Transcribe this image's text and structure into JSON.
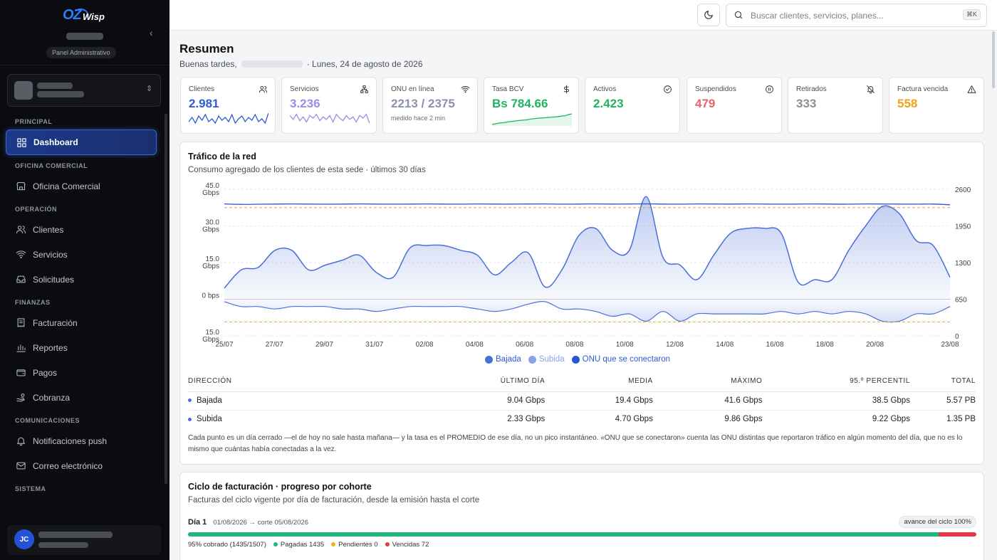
{
  "sidebar": {
    "brand": {
      "mark": "OZ",
      "word": "Wisp"
    },
    "panel_label": "Panel Administrativo",
    "sections": [
      {
        "title": "PRINCIPAL",
        "items": [
          {
            "label": "Dashboard",
            "icon": "grid-icon",
            "active": true
          }
        ]
      },
      {
        "title": "OFICINA COMERCIAL",
        "items": [
          {
            "label": "Oficina Comercial",
            "icon": "store-icon"
          }
        ]
      },
      {
        "title": "OPERACIÓN",
        "items": [
          {
            "label": "Clientes",
            "icon": "users-icon"
          },
          {
            "label": "Servicios",
            "icon": "wifi-icon"
          },
          {
            "label": "Solicitudes",
            "icon": "inbox-icon"
          }
        ]
      },
      {
        "title": "FINANZAS",
        "items": [
          {
            "label": "Facturación",
            "icon": "receipt-icon"
          },
          {
            "label": "Reportes",
            "icon": "bar-chart-icon"
          },
          {
            "label": "Pagos",
            "icon": "wallet-icon"
          },
          {
            "label": "Cobranza",
            "icon": "hand-coins-icon"
          }
        ]
      },
      {
        "title": "COMUNICACIONES",
        "items": [
          {
            "label": "Notificaciones push",
            "icon": "bell-icon"
          },
          {
            "label": "Correo electrónico",
            "icon": "mail-icon"
          }
        ]
      },
      {
        "title": "SISTEMA",
        "items": []
      }
    ],
    "user_initials": "JC"
  },
  "topbar": {
    "search_placeholder": "Buscar clientes, servicios, planes...",
    "shortcut": "⌘K"
  },
  "header": {
    "title": "Resumen",
    "greeting": "Buenas tardes,",
    "date": "· Lunes, 24 de agosto de 2026"
  },
  "kpis": [
    {
      "label": "Clientes",
      "value": "2.981",
      "color": "#2f5bd3",
      "icon": "users-icon"
    },
    {
      "label": "Servicios",
      "value": "3.236",
      "color": "#9d8be6",
      "icon": "network-icon"
    },
    {
      "label": "ONU en línea",
      "value": "2213 / 2375",
      "sub": "medido hace 2 min",
      "color": "#8a93ad",
      "icon": "wifi-icon"
    },
    {
      "label": "Tasa BCV",
      "value": "Bs 784.66",
      "color": "#1fb35f",
      "icon": "dollar-icon"
    },
    {
      "label": "Activos",
      "value": "2.423",
      "color": "#1fb35f",
      "icon": "check-circle-icon"
    },
    {
      "label": "Suspendidos",
      "value": "479",
      "color": "#e8646d",
      "icon": "pause-circle-icon"
    },
    {
      "label": "Retirados",
      "value": "333",
      "color": "#8a8f99",
      "icon": "bell-off-icon"
    },
    {
      "label": "Factura vencida",
      "value": "558",
      "color": "#f0a21a",
      "icon": "alert-triangle-icon"
    }
  ],
  "traffic": {
    "title": "Tráfico de la red",
    "subtitle": "Consumo agregado de los clientes de esta sede · últimos 30 días",
    "legend": [
      {
        "label": "Bajada",
        "color": "#4a6fd6"
      },
      {
        "label": "Subida",
        "color": "#8aa2e6"
      },
      {
        "label": "ONU que se conectaron",
        "color": "#2a55d6"
      }
    ],
    "table": {
      "headers": [
        "DIRECCIÓN",
        "ÚLTIMO DÍA",
        "MEDIA",
        "MÁXIMO",
        "95.º PERCENTIL",
        "TOTAL"
      ],
      "rows": [
        [
          "Bajada",
          "9.04 Gbps",
          "19.4 Gbps",
          "41.6 Gbps",
          "38.5 Gbps",
          "5.57 PB"
        ],
        [
          "Subida",
          "2.33 Gbps",
          "4.70 Gbps",
          "9.86 Gbps",
          "9.22 Gbps",
          "1.35 PB"
        ]
      ]
    },
    "note": "Cada punto es un día cerrado —el de hoy no sale hasta mañana— y la tasa es el PROMEDIO de ese día, no un pico instantáneo. «ONU que se conectaron» cuenta las ONU distintas que reportaron tráfico en algún momento del día, que no es lo mismo que cuántas había conectadas a la vez."
  },
  "chart_data": {
    "type": "area",
    "x": [
      "25/07",
      "26/07",
      "27/07",
      "28/07",
      "29/07",
      "30/07",
      "31/07",
      "01/08",
      "02/08",
      "03/08",
      "04/08",
      "05/08",
      "06/08",
      "07/08",
      "08/08",
      "09/08",
      "10/08",
      "11/08",
      "12/08",
      "13/08",
      "14/08",
      "15/08",
      "16/08",
      "17/08",
      "18/08",
      "19/08",
      "20/08",
      "21/08",
      "22/08",
      "23/08"
    ],
    "xticks": [
      "25/07",
      "27/07",
      "29/07",
      "31/07",
      "02/08",
      "04/08",
      "06/08",
      "08/08",
      "10/08",
      "12/08",
      "14/08",
      "16/08",
      "18/08",
      "20/08",
      "23/08"
    ],
    "y_left_ticks": [
      "45.0 Gbps",
      "30.0 Gbps",
      "15.0 Gbps",
      "0 bps",
      "15.0 Gbps"
    ],
    "y_right_ticks": [
      "2600",
      "1950",
      "1300",
      "650",
      "0"
    ],
    "y_left_range": [
      -15,
      45
    ],
    "y_right_range": [
      0,
      2600
    ],
    "series": [
      {
        "name": "Bajada",
        "unit": "Gbps",
        "values": [
          4.5,
          12,
          13,
          20,
          20,
          12,
          14,
          16,
          18,
          11,
          9,
          21,
          22,
          22,
          20,
          18,
          10,
          15,
          19,
          5,
          12,
          26,
          29,
          20,
          20,
          42,
          17,
          14,
          8,
          18,
          27,
          29,
          29,
          27,
          7,
          8,
          8,
          20,
          30,
          38,
          35,
          24,
          22,
          9
        ]
      },
      {
        "name": "Subida",
        "unit": "Gbps",
        "values": [
          -1,
          -3,
          -3,
          -4,
          -3,
          -3,
          -3,
          -4,
          -4,
          -5,
          -4,
          -3,
          -3,
          -3,
          -3,
          -4,
          -5,
          -4,
          -2,
          -1,
          -4,
          -4,
          -5,
          -7,
          -6,
          -9,
          -5,
          -9,
          -6,
          -6,
          -6,
          -6,
          -6,
          -5,
          -6,
          -5,
          -6,
          -5,
          -6,
          -9,
          -9,
          -6,
          -6,
          -3
        ]
      },
      {
        "name": "ONU que se conectaron",
        "values": [
          2340,
          2332,
          2335,
          2337,
          2340,
          2338,
          2335,
          2337,
          2340,
          2338,
          2336,
          2338,
          2340,
          2338,
          2336,
          2340,
          2338,
          2337,
          2339,
          2340,
          2336,
          2338,
          2340,
          2338,
          2339,
          2341,
          2338,
          2336,
          2340,
          2339,
          2337,
          2340,
          2338,
          2336,
          2338,
          2340,
          2337,
          2336,
          2340,
          2339,
          2337,
          2336,
          2338,
          2325
        ]
      }
    ],
    "reference_lines": [
      {
        "axis": "left",
        "value": 37.5,
        "color": "#e8a23a"
      },
      {
        "axis": "left",
        "value": -9.3,
        "color": "#e8a23a"
      }
    ],
    "grid": true
  },
  "billing": {
    "title": "Ciclo de facturación · progreso por cohorte",
    "subtitle": "Facturas del ciclo vigente por día de facturación, desde la emisión hasta el corte",
    "cohort": {
      "day": "Día 1",
      "range": "01/08/2026 → corte 05/08/2026",
      "cycle_badge": "avance del ciclo 100%",
      "collected": "95% cobrado (1435/1507)",
      "paid": "Pagadas 1435",
      "pending": "Pendientes 0",
      "overdue": "Vencidas 72",
      "paid_frac": 0.952,
      "overdue_frac": 0.048,
      "colors": {
        "paid": "#1fb77a",
        "pending": "#f0b30f",
        "overdue": "#e6384a"
      }
    }
  }
}
